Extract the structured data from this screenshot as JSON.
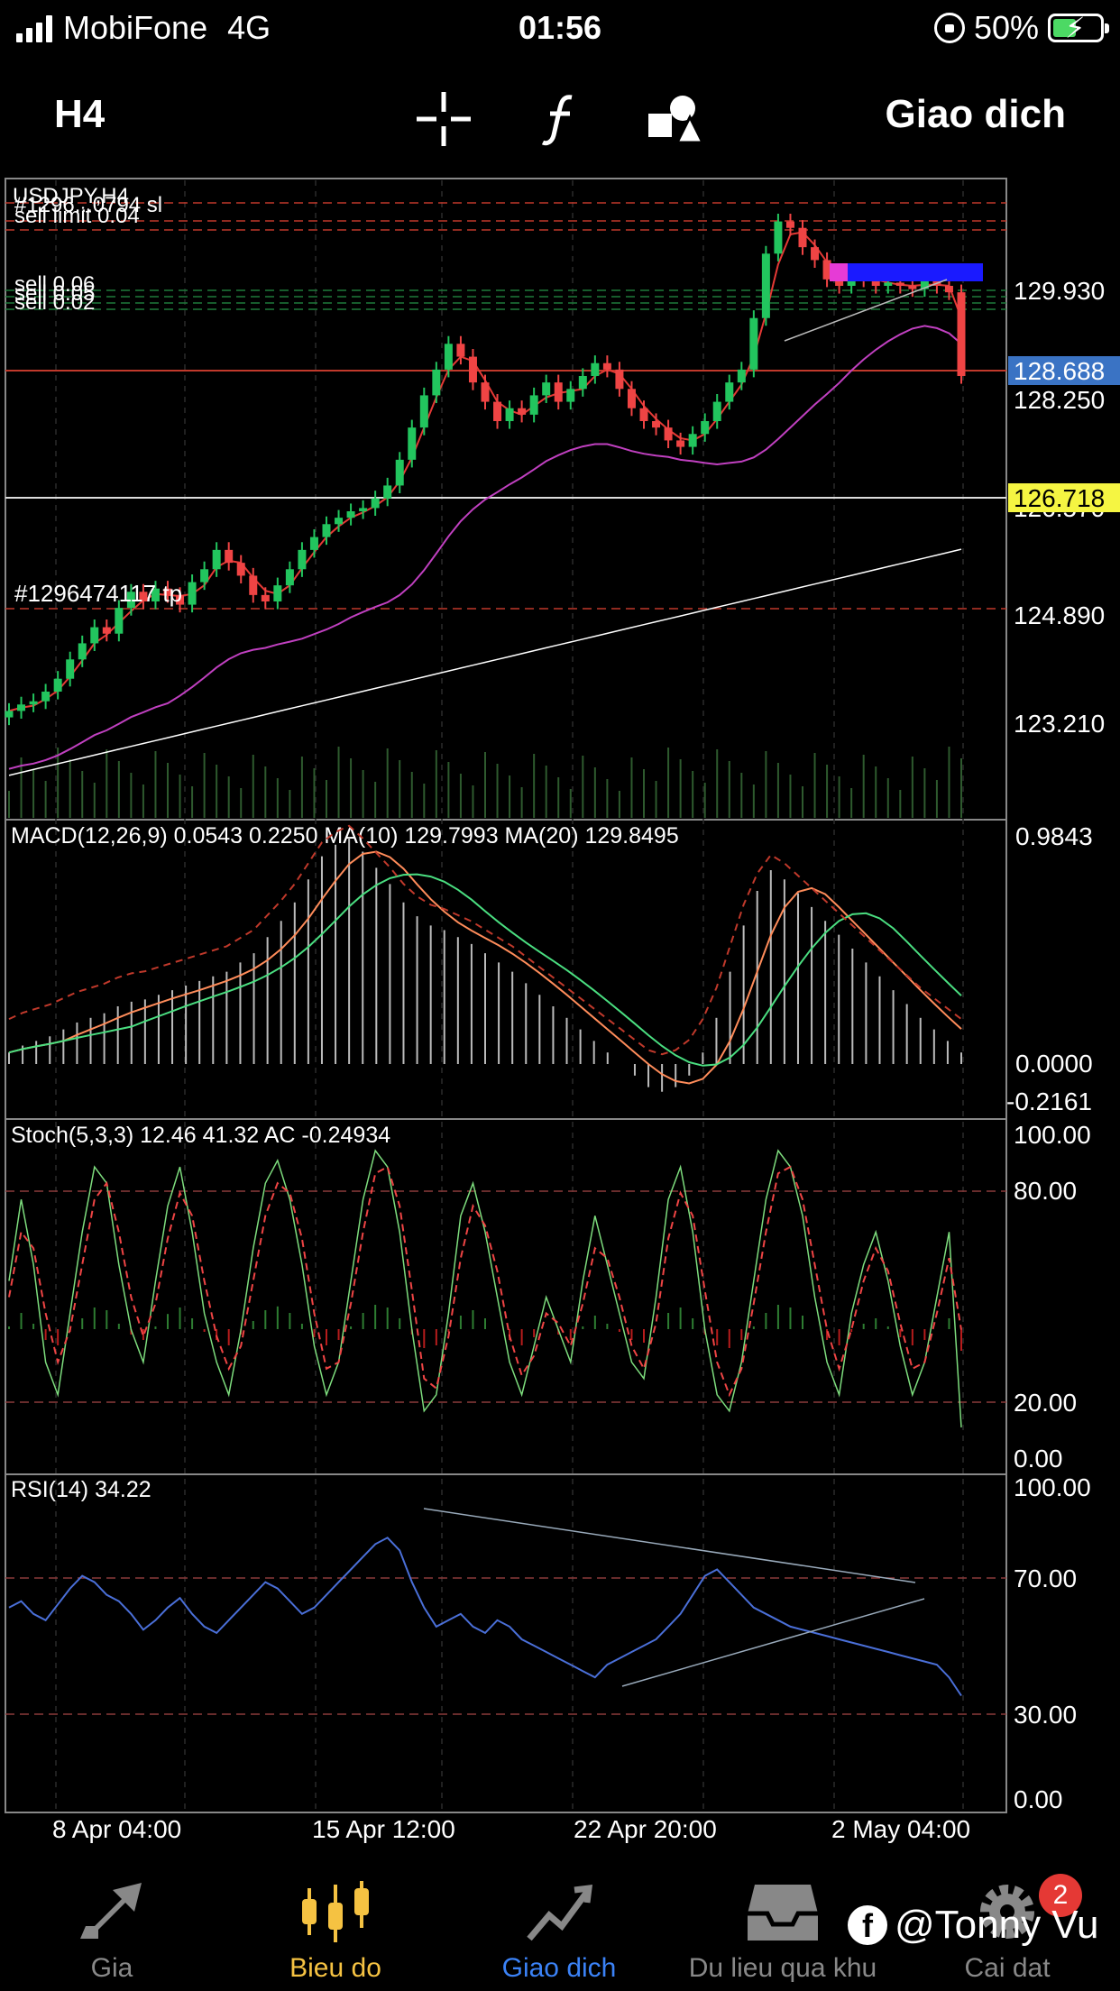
{
  "status_bar": {
    "carrier": "MobiFone",
    "network": "4G",
    "time": "01:56",
    "battery": "50%"
  },
  "toolbar": {
    "timeframe": "H4",
    "trade_label": "Giao dich",
    "icons": [
      "crosshair-icon",
      "function-icon",
      "objects-icon"
    ]
  },
  "chart": {
    "symbol_label": "USDJPY,H4",
    "order_labels": [
      "#1296...0794 sl",
      "sell limit 0.04",
      "sell 0.06",
      "sell 0.05",
      "sell 0.02"
    ],
    "tp_label": "#1296474117 tp",
    "price_axis": [
      "129.930",
      "128.250",
      "126.570",
      "124.890",
      "123.210"
    ],
    "bid_price": "128.688",
    "level_price": "126.718",
    "macd": {
      "label": "MACD(12,26,9) 0.0543 0.2250 MA(10) 129.7993 MA(20) 129.8495",
      "axis": [
        "0.9843",
        "0.0000",
        "-0.2161"
      ]
    },
    "stoch": {
      "label": "Stoch(5,3,3) 12.46 41.32 AC -0.24934",
      "axis": [
        "100.00",
        "80.00",
        "20.00",
        "0.00"
      ]
    },
    "rsi": {
      "label": "RSI(14) 34.22",
      "axis": [
        "100.00",
        "70.00",
        "30.00",
        "0.00"
      ]
    },
    "time_axis": [
      "8 Apr 04:00",
      "15 Apr 12:00",
      "22 Apr 20:00",
      "2 May 04:00"
    ]
  },
  "chart_data": {
    "type": "candlestick",
    "symbol": "USDJPY",
    "timeframe": "H4",
    "close": [
      123.4,
      123.5,
      123.55,
      123.7,
      123.9,
      124.2,
      124.45,
      124.7,
      124.6,
      125.0,
      125.25,
      125.1,
      125.3,
      125.2,
      125.05,
      125.4,
      125.6,
      125.9,
      125.7,
      125.5,
      125.2,
      125.1,
      125.35,
      125.6,
      125.9,
      126.1,
      126.3,
      126.4,
      126.5,
      126.55,
      126.7,
      126.9,
      127.3,
      127.8,
      128.3,
      128.7,
      129.1,
      128.9,
      128.5,
      128.2,
      127.9,
      128.1,
      128.0,
      128.3,
      128.5,
      128.2,
      128.4,
      128.6,
      128.8,
      128.7,
      128.4,
      128.1,
      127.9,
      127.8,
      127.6,
      127.5,
      127.7,
      127.9,
      128.2,
      128.5,
      128.7,
      129.5,
      130.5,
      131.0,
      130.9,
      130.6,
      130.4,
      130.1,
      130.0,
      130.2,
      130.1,
      130.0,
      130.05,
      130.0,
      129.95,
      130.1,
      130.0,
      129.9,
      128.6
    ],
    "sma_fast_color": "#e53935",
    "sma_mid_color": "#c040c0",
    "sma_slow_color": "#ffffff",
    "bull_color": "#22c55e",
    "bear_color": "#ef4444",
    "macd_ma10_color": "#ff8c5a",
    "macd_ma20_color": "#4ade80",
    "stoch_main_color": "#7ddc7d",
    "stoch_signal_color": "#ef4444",
    "rsi_color": "#4a6fd8",
    "stoch_main": [
      55,
      80,
      60,
      30,
      20,
      45,
      70,
      90,
      85,
      60,
      40,
      30,
      55,
      78,
      90,
      70,
      45,
      30,
      20,
      40,
      65,
      85,
      92,
      80,
      60,
      35,
      20,
      30,
      55,
      80,
      95,
      90,
      70,
      40,
      15,
      20,
      45,
      75,
      85,
      70,
      50,
      30,
      20,
      35,
      50,
      40,
      30,
      55,
      75,
      60,
      45,
      30,
      25,
      50,
      80,
      90,
      70,
      40,
      20,
      15,
      30,
      55,
      80,
      95,
      90,
      75,
      50,
      30,
      20,
      45,
      60,
      70,
      55,
      35,
      20,
      30,
      50,
      70,
      10
    ],
    "stoch_signal": [
      50,
      70,
      65,
      45,
      30,
      40,
      60,
      80,
      85,
      70,
      50,
      38,
      48,
      68,
      82,
      75,
      55,
      38,
      28,
      35,
      55,
      75,
      85,
      82,
      68,
      45,
      28,
      30,
      48,
      70,
      88,
      90,
      78,
      52,
      25,
      22,
      38,
      62,
      78,
      72,
      58,
      38,
      26,
      32,
      45,
      42,
      35,
      48,
      65,
      62,
      50,
      35,
      28,
      42,
      68,
      82,
      75,
      52,
      30,
      20,
      28,
      48,
      70,
      88,
      90,
      80,
      60,
      40,
      28,
      40,
      55,
      65,
      58,
      42,
      28,
      30,
      45,
      62,
      40
    ],
    "rsi": [
      62,
      64,
      60,
      58,
      63,
      68,
      72,
      70,
      66,
      64,
      60,
      55,
      58,
      62,
      65,
      60,
      56,
      54,
      58,
      62,
      66,
      70,
      68,
      64,
      60,
      62,
      66,
      70,
      74,
      78,
      82,
      84,
      80,
      70,
      62,
      56,
      58,
      60,
      56,
      54,
      58,
      56,
      52,
      50,
      48,
      46,
      44,
      42,
      40,
      44,
      46,
      48,
      50,
      52,
      56,
      60,
      66,
      72,
      74,
      70,
      66,
      62,
      60,
      58,
      56,
      55,
      54,
      53,
      52,
      51,
      50,
      49,
      48,
      47,
      46,
      45,
      44,
      40,
      34.22
    ],
    "macd_hist": [
      0.05,
      0.08,
      0.1,
      0.12,
      0.15,
      0.18,
      0.2,
      0.22,
      0.25,
      0.27,
      0.28,
      0.3,
      0.32,
      0.34,
      0.36,
      0.38,
      0.4,
      0.44,
      0.48,
      0.55,
      0.62,
      0.7,
      0.8,
      0.9,
      0.95,
      0.98,
      0.92,
      0.85,
      0.78,
      0.7,
      0.64,
      0.6,
      0.58,
      0.55,
      0.52,
      0.48,
      0.44,
      0.4,
      0.35,
      0.3,
      0.25,
      0.2,
      0.15,
      0.1,
      0.05,
      0.0,
      -0.05,
      -0.1,
      -0.12,
      -0.1,
      -0.05,
      0.05,
      0.2,
      0.4,
      0.6,
      0.75,
      0.84,
      0.8,
      0.74,
      0.68,
      0.62,
      0.56,
      0.5,
      0.44,
      0.38,
      0.32,
      0.26,
      0.2,
      0.15,
      0.1,
      0.05
    ]
  },
  "tabbar": {
    "tabs": [
      {
        "label": "Gia",
        "icon": "arrows-icon"
      },
      {
        "label": "Bieu do",
        "icon": "candles-icon"
      },
      {
        "label": "Giao dich",
        "icon": "trend-icon"
      },
      {
        "label": "Du lieu qua khu",
        "icon": "inbox-icon"
      },
      {
        "label": "Cai dat",
        "icon": "gear-icon"
      }
    ],
    "settings_badge": "2"
  },
  "watermark": "@Tonny Vu"
}
